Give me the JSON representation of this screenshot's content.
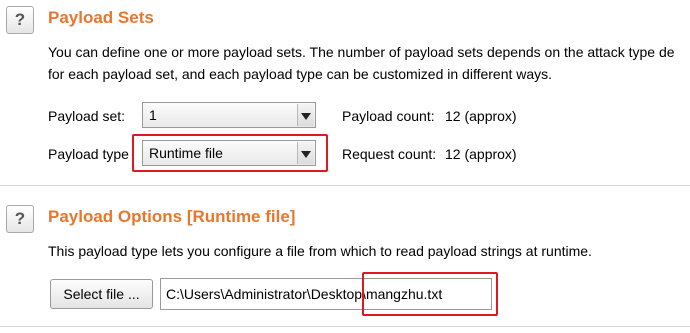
{
  "payload_sets": {
    "help_icon": "question-mark-icon",
    "help_glyph": "?",
    "title": "Payload Sets",
    "description_line1": "You can define one or more payload sets. The number of payload sets depends on the attack type de",
    "description_line2": "for each payload set, and each payload type can be customized in different ways.",
    "payload_set_label": "Payload set:",
    "payload_set_value": "1",
    "payload_type_label": "Payload type",
    "payload_type_value": "Runtime file",
    "payload_count_label": "Payload count:",
    "payload_count_value": "12 (approx)",
    "request_count_label": "Request count:",
    "request_count_value": "12 (approx)"
  },
  "payload_options": {
    "help_icon": "question-mark-icon",
    "help_glyph": "?",
    "title": "Payload Options [Runtime file]",
    "description": "This payload type lets you configure a file from which to read payload strings at runtime.",
    "select_file_label": "Select file ...",
    "file_path": "C:\\Users\\Administrator\\Desktop\\mangzhu.txt"
  },
  "colors": {
    "title_orange": "#e8772e",
    "highlight_red": "#e0181f"
  }
}
